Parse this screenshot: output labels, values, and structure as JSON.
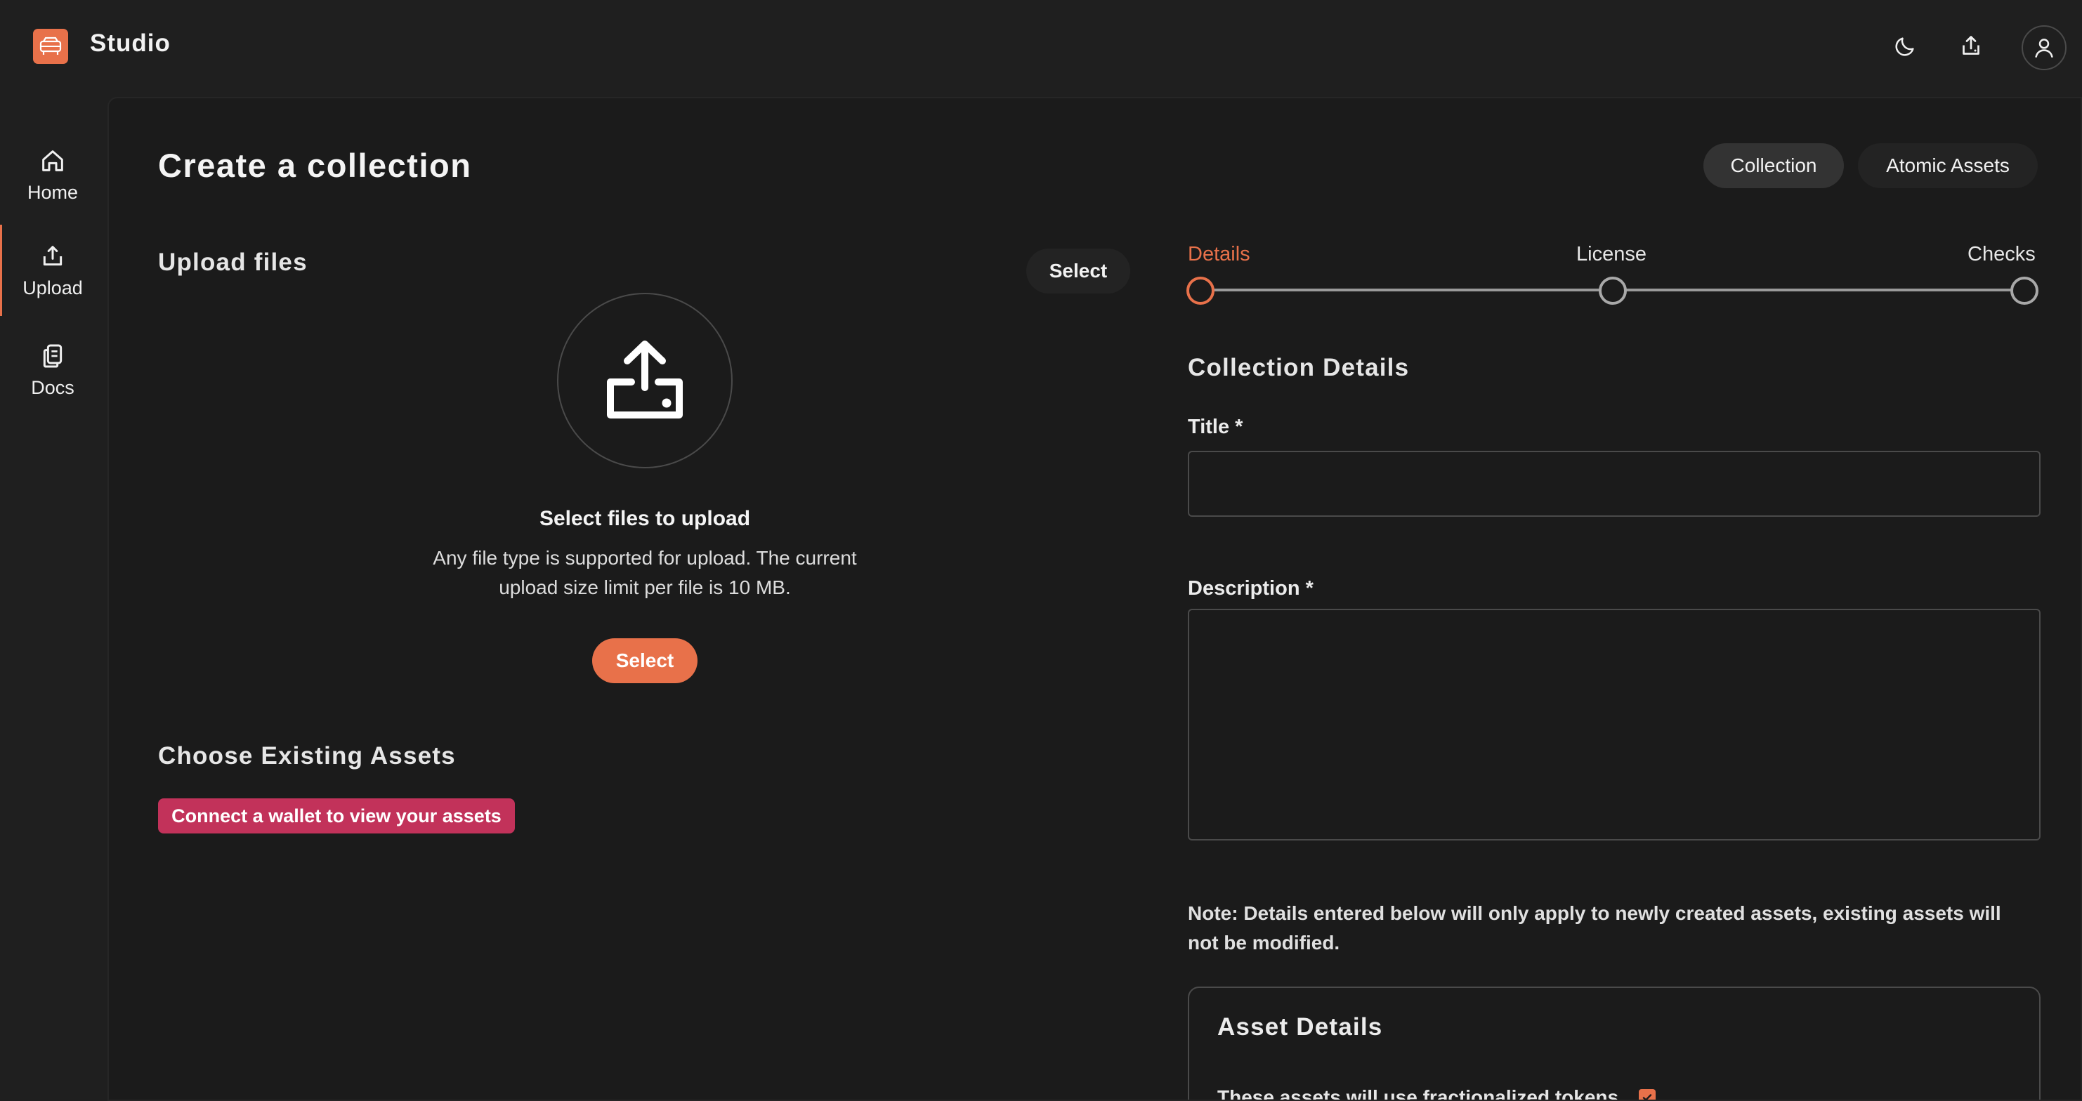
{
  "app": {
    "title": "Studio"
  },
  "topbar": {
    "icons": [
      "moon-icon",
      "upload-icon",
      "user-icon"
    ]
  },
  "sidebar": {
    "items": [
      {
        "label": "Home",
        "icon": "home-icon"
      },
      {
        "label": "Upload",
        "icon": "upload-icon"
      },
      {
        "label": "Docs",
        "icon": "docs-icon"
      }
    ]
  },
  "page": {
    "title": "Create a collection",
    "tabs": [
      "Collection",
      "Atomic Assets"
    ]
  },
  "upload": {
    "section_title": "Upload files",
    "select_label": "Select",
    "heading": "Select files to upload",
    "desc_line1": "Any file type is supported for upload. The current",
    "desc_line2": "upload size limit per file is 10 MB.",
    "select_primary_label": "Select"
  },
  "existing": {
    "section_title": "Choose Existing Assets",
    "wallet_button": "Connect a wallet to view your assets"
  },
  "steps": [
    "Details",
    "License",
    "Checks"
  ],
  "form": {
    "section_title": "Collection Details",
    "title_label": "Title *",
    "title_value": "",
    "description_label": "Description *",
    "description_value": "",
    "note_line1": "Note: Details entered below will only apply to newly created assets, existing assets will",
    "note_line2": "not be modified."
  },
  "asset_details": {
    "title": "Asset Details",
    "fractionalized_label": "These assets will use fractionalized tokens",
    "fractionalized_checked": true
  },
  "colors": {
    "accent": "#e8714a",
    "wallet": "#c2325a",
    "background": "#1f1f1f",
    "panel": "#1b1b1b"
  }
}
